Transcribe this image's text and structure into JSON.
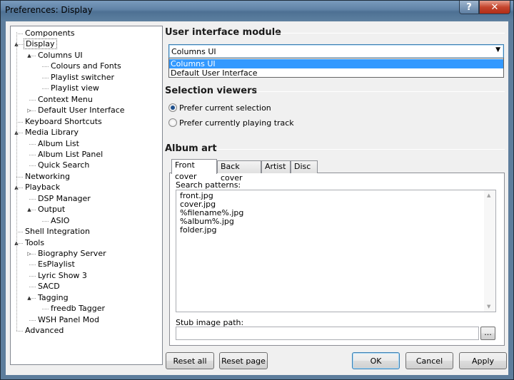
{
  "window": {
    "title": "Preferences: Display",
    "help_glyph": "?",
    "close_glyph": "✕"
  },
  "tree": {
    "items": [
      {
        "label": "Components",
        "level": 0,
        "expander": ""
      },
      {
        "label": "Display",
        "level": 0,
        "expander": "▲",
        "selected": true
      },
      {
        "label": "Columns UI",
        "level": 1,
        "expander": "▲"
      },
      {
        "label": "Colours and Fonts",
        "level": 2,
        "expander": ""
      },
      {
        "label": "Playlist switcher",
        "level": 2,
        "expander": ""
      },
      {
        "label": "Playlist view",
        "level": 2,
        "expander": ""
      },
      {
        "label": "Context Menu",
        "level": 1,
        "expander": ""
      },
      {
        "label": "Default User Interface",
        "level": 1,
        "expander": "▷"
      },
      {
        "label": "Keyboard Shortcuts",
        "level": 0,
        "expander": ""
      },
      {
        "label": "Media Library",
        "level": 0,
        "expander": "▲"
      },
      {
        "label": "Album List",
        "level": 1,
        "expander": ""
      },
      {
        "label": "Album List Panel",
        "level": 1,
        "expander": ""
      },
      {
        "label": "Quick Search",
        "level": 1,
        "expander": ""
      },
      {
        "label": "Networking",
        "level": 0,
        "expander": ""
      },
      {
        "label": "Playback",
        "level": 0,
        "expander": "▲"
      },
      {
        "label": "DSP Manager",
        "level": 1,
        "expander": ""
      },
      {
        "label": "Output",
        "level": 1,
        "expander": "▲"
      },
      {
        "label": "ASIO",
        "level": 2,
        "expander": ""
      },
      {
        "label": "Shell Integration",
        "level": 0,
        "expander": ""
      },
      {
        "label": "Tools",
        "level": 0,
        "expander": "▲"
      },
      {
        "label": "Biography Server",
        "level": 1,
        "expander": "▷"
      },
      {
        "label": "EsPlaylist",
        "level": 1,
        "expander": ""
      },
      {
        "label": "Lyric Show 3",
        "level": 1,
        "expander": ""
      },
      {
        "label": "SACD",
        "level": 1,
        "expander": ""
      },
      {
        "label": "Tagging",
        "level": 1,
        "expander": "▲"
      },
      {
        "label": "freedb Tagger",
        "level": 2,
        "expander": ""
      },
      {
        "label": "WSH Panel Mod",
        "level": 1,
        "expander": ""
      },
      {
        "label": "Advanced",
        "level": 0,
        "expander": ""
      }
    ]
  },
  "ui_module": {
    "heading": "User interface module",
    "selected": "Columns UI",
    "arrow": "▼",
    "options": [
      "Columns UI",
      "Default User Interface"
    ],
    "highlighted_index": 0
  },
  "selection_viewers": {
    "heading": "Selection viewers",
    "options": [
      {
        "label": "Prefer current selection",
        "checked": true
      },
      {
        "label": "Prefer currently playing track",
        "checked": false
      }
    ]
  },
  "album_art": {
    "heading": "Album art",
    "tabs": [
      "Front cover",
      "Back cover",
      "Artist",
      "Disc"
    ],
    "active_tab": 0,
    "patterns_label": "Search patterns:",
    "patterns": [
      "front.jpg",
      "cover.jpg",
      "%filename%.jpg",
      "%album%.jpg",
      "folder.jpg"
    ],
    "stub_label": "Stub image path:",
    "stub_value": "",
    "browse_label": "..."
  },
  "footer": {
    "reset_all": "Reset all",
    "reset_page": "Reset page",
    "ok": "OK",
    "cancel": "Cancel",
    "apply": "Apply"
  },
  "colors": {
    "selection_highlight": "#3399ff",
    "frame": "#5d7d9c",
    "close_button": "#c4452d"
  }
}
